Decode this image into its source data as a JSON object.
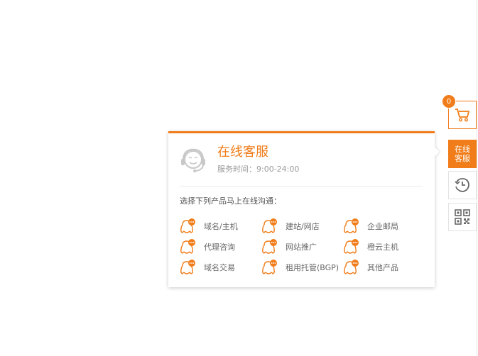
{
  "panel": {
    "title": "在线客服",
    "service_time": "服务时间：9:00-24:00",
    "prompt": "选择下列产品马上在线沟通：",
    "items": [
      {
        "label": "域名/主机"
      },
      {
        "label": "建站/网店"
      },
      {
        "label": "企业邮局"
      },
      {
        "label": "代理咨询"
      },
      {
        "label": "网站推广"
      },
      {
        "label": "橙云主机"
      },
      {
        "label": "域名交易"
      },
      {
        "label": "租用托管(BGP)"
      },
      {
        "label": "其他产品"
      }
    ]
  },
  "sidebar": {
    "cart_count": "0",
    "service_line1": "在线",
    "service_line2": "客服"
  },
  "colors": {
    "accent": "#f07d1a",
    "text_gray": "#666666",
    "border": "#e3e3e3"
  },
  "icons": {
    "agent": "headset-agent-icon",
    "qq": "qq-chat-icon",
    "cart": "shopping-cart-icon",
    "clock": "clock-icon",
    "qr": "qr-code-icon"
  }
}
